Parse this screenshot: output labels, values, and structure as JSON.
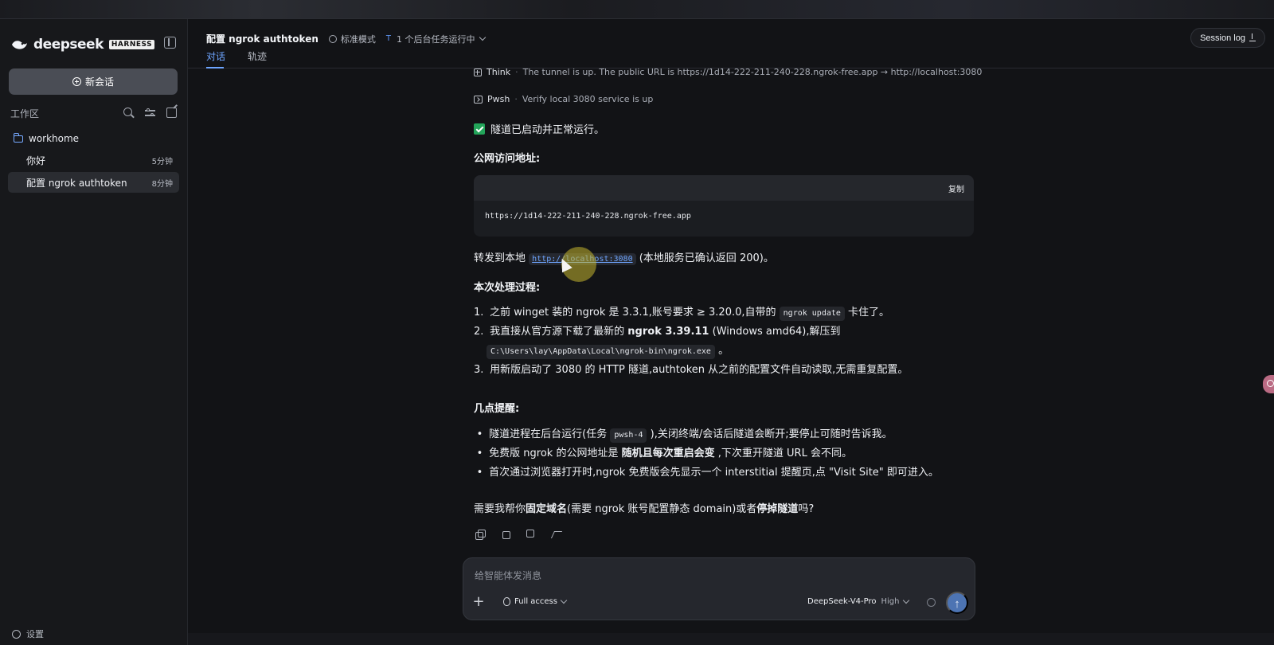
{
  "sidebar": {
    "brand": "deepseek",
    "badge": "HARNESS",
    "new_chat": "新会话",
    "workspace_label": "工作区",
    "folder": "workhome",
    "sessions": [
      {
        "title": "你好",
        "time": "5分钟"
      },
      {
        "title": "配置 ngrok authtoken",
        "time": "8分钟"
      }
    ],
    "settings_label": "设置"
  },
  "header": {
    "title": "配置 ngrok authtoken",
    "mode": "标准模式",
    "background_tasks": "1 个后台任务运行中",
    "tabs": [
      "对话",
      "轨迹"
    ],
    "session_log": "Session log"
  },
  "conversation": {
    "trace": [
      {
        "label": "Think",
        "text": "The tunnel is up. The public URL is https://1d14-222-211-240-228.ngrok-free.app → http://localhost:3080"
      },
      {
        "label": "Pwsh",
        "text": "Verify local 3080 service is up"
      }
    ],
    "status": "隧道已启动并正常运行。",
    "public_heading": "公网访问地址:",
    "copy": "复制",
    "public_url": "https://1d14-222-211-240-228.ngrok-free.app",
    "forward_prefix": "转发到本地",
    "forward_link": "http://localhost:3080",
    "forward_suffix": "(本地服务已确认返回 200)。",
    "process_heading": "本次处理过程:",
    "steps": {
      "s1_prefix": "之前 winget 装的 ngrok 是 3.3.1,账号要求 ≥ 3.20.0,自带的",
      "s1_code": "ngrok update",
      "s1_suffix": "卡住了。",
      "s2_prefix": "我直接从官方源下载了最新的",
      "s2_strong": "ngrok 3.39.11",
      "s2_suffix": "(Windows amd64),解压到",
      "s2_path": "C:\\Users\\lay\\AppData\\Local\\ngrok-bin\\ngrok.exe",
      "s2_end": "。",
      "s3": "用新版启动了 3080 的 HTTP 隧道,authtoken 从之前的配置文件自动读取,无需重复配置。"
    },
    "notes_heading": "几点提醒:",
    "notes": {
      "n1_prefix": "隧道进程在后台运行(任务",
      "n1_code": "pwsh-4",
      "n1_suffix": "),关闭终端/会话后隧道会断开;要停止可随时告诉我。",
      "n2_prefix": "免费版 ngrok 的公网地址是",
      "n2_strong": "随机且每次重启会变",
      "n2_suffix": ",下次重开隧道 URL 会不同。",
      "n3": "首次通过浏览器打开时,ngrok 免费版会先显示一个 interstitial 提醒页,点 \"Visit Site\" 即可进入。"
    },
    "question_prefix": "需要我帮你",
    "question_strong_1": "固定域名",
    "question_middle": "(需要 ngrok 账号配置静态 domain)或者",
    "question_strong_2": "停掉隧道",
    "question_suffix": "吗?"
  },
  "composer": {
    "placeholder": "给智能体发消息",
    "access": "Full access",
    "model": "DeepSeek-V4-Pro",
    "effort": "High",
    "send_symbol": "↑",
    "plus_symbol": "+"
  },
  "colors": {
    "background": "#121316",
    "sidebar": "#17181b",
    "accent": "#6ea5ff",
    "success": "#23a55a"
  },
  "icons": [
    "deepseek-logo",
    "sidebar-collapse-icon",
    "plus-circle-icon",
    "search-icon",
    "filter-icon",
    "compose-icon",
    "folder-icon",
    "gear-icon",
    "mode-icon",
    "download-icon",
    "think-icon",
    "terminal-icon",
    "check-icon",
    "copy-icon",
    "thumb-up-icon",
    "thumb-down-icon",
    "branch-icon",
    "shield-icon",
    "spinner-icon",
    "arrow-up-icon"
  ]
}
